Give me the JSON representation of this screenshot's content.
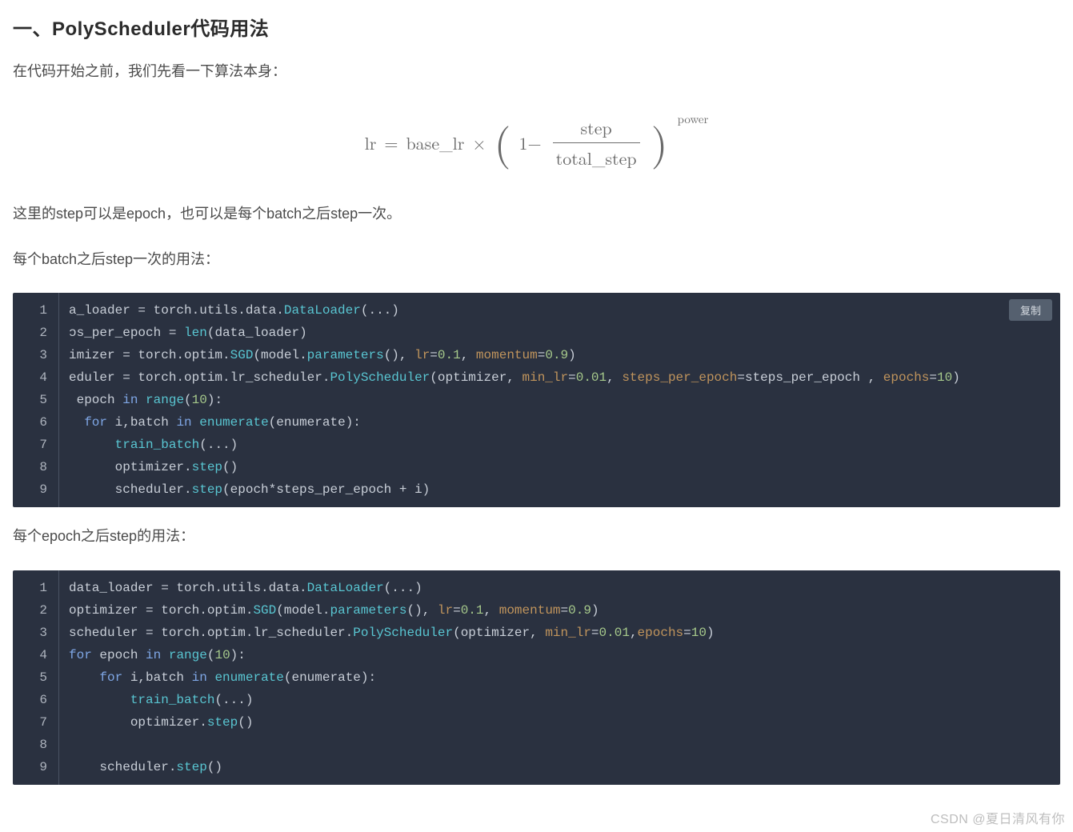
{
  "title": "一、PolyScheduler代码用法",
  "para1": "在代码开始之前，我们先看一下算法本身：",
  "formula": {
    "lhs": "lr",
    "eq": "=",
    "baselr": "base_lr",
    "times": "×",
    "one_minus": "1−",
    "frac_num": "step",
    "frac_den": "total_step",
    "power_label": "power"
  },
  "para2": "这里的step可以是epoch，也可以是每个batch之后step一次。",
  "para3": "每个batch之后step一次的用法：",
  "copy_label": "复制",
  "code1": {
    "line_numbers": [
      "1",
      "2",
      "3",
      "4",
      "5",
      "6",
      "7",
      "8",
      "9"
    ],
    "lines_html": [
      "a_loader = torch.utils.data.<span class=\"tk-fn\">DataLoader</span>(...)",
      "ɔs_per_epoch = <span class=\"tk-fn\">len</span>(data_loader)",
      "imizer = torch.optim.<span class=\"tk-fn\">SGD</span>(model.<span class=\"tk-fn\">parameters</span>(), <span class=\"tk-arg\">lr</span>=<span class=\"tk-num\">0.1</span>, <span class=\"tk-arg\">momentum</span>=<span class=\"tk-num\">0.9</span>)",
      "eduler = torch.optim.lr_scheduler.<span class=\"tk-fn\">PolyScheduler</span>(optimizer, <span class=\"tk-arg\">min_lr</span>=<span class=\"tk-num\">0.01</span>, <span class=\"tk-arg\">steps_per_epoch</span>=steps_per_epoch , <span class=\"tk-arg\">epochs</span>=<span class=\"tk-num\">10</span>)",
      " epoch <span class=\"tk-kw\">in</span> <span class=\"tk-fn\">range</span>(<span class=\"tk-num\">10</span>):",
      "  <span class=\"tk-kw\">for</span> i,batch <span class=\"tk-kw\">in</span> <span class=\"tk-fn\">enumerate</span>(enumerate):",
      "      <span class=\"tk-fn\">train_batch</span>(...)",
      "      optimizer.<span class=\"tk-fn\">step</span>()",
      "      scheduler.<span class=\"tk-fn\">step</span>(epoch*steps_per_epoch + i)"
    ]
  },
  "para4": "每个epoch之后step的用法：",
  "code2": {
    "line_numbers": [
      "1",
      "2",
      "3",
      "4",
      "5",
      "6",
      "7",
      "8",
      "9"
    ],
    "lines_html": [
      "data_loader = torch.utils.data.<span class=\"tk-fn\">DataLoader</span>(...)",
      "optimizer = torch.optim.<span class=\"tk-fn\">SGD</span>(model.<span class=\"tk-fn\">parameters</span>(), <span class=\"tk-arg\">lr</span>=<span class=\"tk-num\">0.1</span>, <span class=\"tk-arg\">momentum</span>=<span class=\"tk-num\">0.9</span>)",
      "scheduler = torch.optim.lr_scheduler.<span class=\"tk-fn\">PolyScheduler</span>(optimizer, <span class=\"tk-arg\">min_lr</span>=<span class=\"tk-num\">0.01</span>,<span class=\"tk-arg\">epochs</span>=<span class=\"tk-num\">10</span>)",
      "<span class=\"tk-kw\">for</span> epoch <span class=\"tk-kw\">in</span> <span class=\"tk-fn\">range</span>(<span class=\"tk-num\">10</span>):",
      "    <span class=\"tk-kw\">for</span> i,batch <span class=\"tk-kw\">in</span> <span class=\"tk-fn\">enumerate</span>(enumerate):",
      "        <span class=\"tk-fn\">train_batch</span>(...)",
      "        optimizer.<span class=\"tk-fn\">step</span>()",
      " ",
      "    scheduler.<span class=\"tk-fn\">step</span>()"
    ]
  },
  "watermark": "CSDN @夏日清风有你"
}
